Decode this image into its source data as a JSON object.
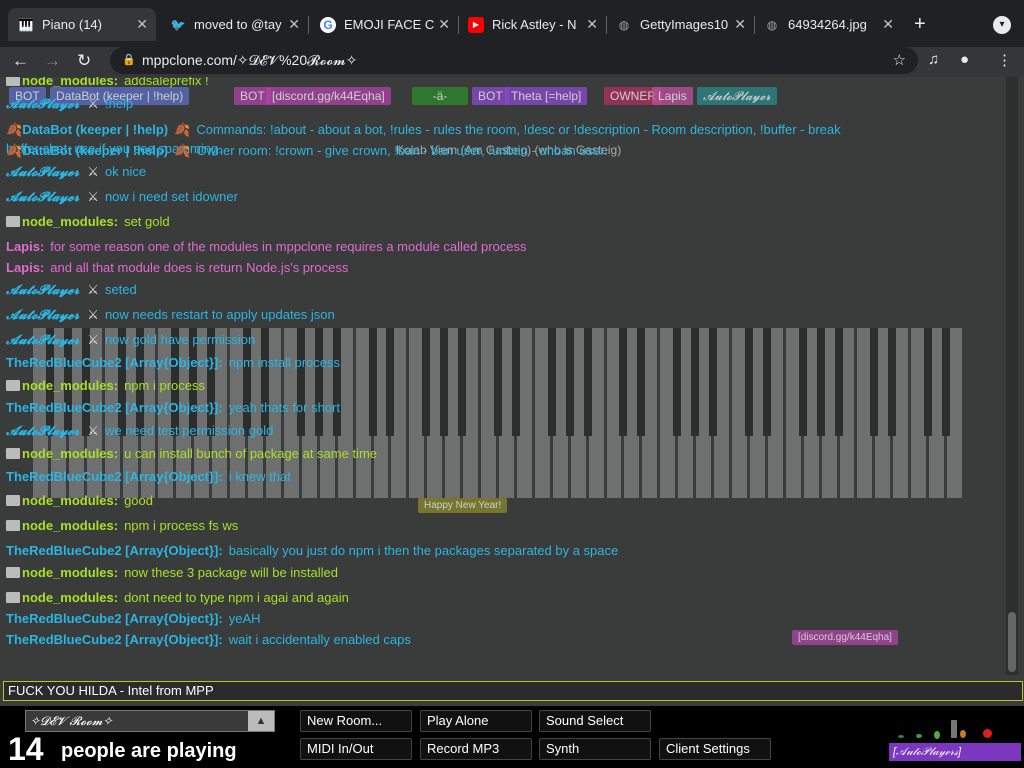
{
  "browser": {
    "tabs": [
      {
        "title": "Piano (14)",
        "icon": "piano-icon"
      },
      {
        "title": "moved to @tay",
        "icon": "twitter-icon"
      },
      {
        "title": "EMOJI FACE C",
        "icon": "google-icon"
      },
      {
        "title": "Rick Astley - N",
        "icon": "youtube-icon"
      },
      {
        "title": "GettyImages10",
        "icon": "globe-icon"
      },
      {
        "title": "64934264.jpg",
        "icon": "globe-icon"
      }
    ],
    "new_tab": "+",
    "url": "mppclone.com/✧𝓓𝓔𝓥%20𝓡𝓸𝓸𝓶✧"
  },
  "colors": {
    "accent": "#b9c728",
    "lime": "#a8e028",
    "cyan": "#2bb5e3",
    "pink": "#e06ad0"
  },
  "overlay_tags": [
    {
      "text": "BOT",
      "color": "#5b6fc8"
    },
    {
      "text": "DataBot (keeper | !help)",
      "color": "#5b6fc8"
    },
    {
      "text": "BOT",
      "color": "#b044a8"
    },
    {
      "text": "[discord.gg/k44Eqha]",
      "color": "#b044a8"
    },
    {
      "text": "-ä-",
      "color": "#2c8a2c"
    },
    {
      "text": "BOT",
      "color": "#8a4ad0"
    },
    {
      "text": "Theta [=help]",
      "color": "#8a4ad0"
    },
    {
      "text": "OWNER",
      "color": "#b03060"
    },
    {
      "text": "Lapis",
      "color": "#c050a0"
    },
    {
      "text": "𝓐𝓾𝓽𝓸𝓟𝓵𝓪𝔂𝓮𝓻",
      "color": "#2a8a8a"
    },
    {
      "text": "Kolab Viem (Am Gasteig) (who is Gasteig)",
      "color": "#3a3b3b"
    },
    {
      "text": "Happy New Year!",
      "color": "#8a8a2a"
    },
    {
      "text": "[discord.gg/k44Eqha]",
      "color": "#b044a8"
    }
  ],
  "chat": [
    {
      "name": "node_modules:",
      "text": "addsaleprefix !",
      "color": "#a8e028",
      "folder": true
    },
    {
      "name": "𝓐𝓾𝓽𝓸𝓟𝓵𝓪𝔂𝓮𝓻",
      "text": "!help",
      "color": "#2bb5e3",
      "sword": true
    },
    {
      "name": "DataBot (keeper | !help)",
      "text": "Commands: !about - about a bot, !rules - rules the room, !desc or !description - Room description, !buffer - break",
      "text2": "buffer chat, use if you see spamming.",
      "color": "#2bb5e3",
      "prefix": "🍂",
      "suffix": "🍂"
    },
    {
      "name": "DataBot (keeper | !help)",
      "text": "Owner room: !crown - give crown, !ban - ban user, !unban - unban user.",
      "color": "#2bb5e3",
      "prefix": "🍂",
      "suffix": "🍂"
    },
    {
      "name": "𝓐𝓾𝓽𝓸𝓟𝓵𝓪𝔂𝓮𝓻",
      "text": "ok nice",
      "color": "#2bb5e3",
      "sword": true
    },
    {
      "name": "𝓐𝓾𝓽𝓸𝓟𝓵𝓪𝔂𝓮𝓻",
      "text": "now i need set idowner",
      "color": "#2bb5e3",
      "sword": true
    },
    {
      "name": "node_modules:",
      "text": "set gold",
      "color": "#a8e028",
      "folder": true
    },
    {
      "name": "Lapis:",
      "text": "for some reason one of the modules in mppclone requires a module called process",
      "color": "#e06ad0"
    },
    {
      "name": "Lapis:",
      "text": "and all that module does is return Node.js's process",
      "color": "#e06ad0"
    },
    {
      "name": "𝓐𝓾𝓽𝓸𝓟𝓵𝓪𝔂𝓮𝓻",
      "text": "seted",
      "color": "#2bb5e3",
      "sword": true
    },
    {
      "name": "𝓐𝓾𝓽𝓸𝓟𝓵𝓪𝔂𝓮𝓻",
      "text": "now needs restart to apply updates json",
      "color": "#2bb5e3",
      "sword": true
    },
    {
      "name": "𝓐𝓾𝓽𝓸𝓟𝓵𝓪𝔂𝓮𝓻",
      "text": "now gold have permission",
      "color": "#2bb5e3",
      "sword": true
    },
    {
      "name": "TheRedBlueCube2 [Array{Object}]:",
      "text": "npm install process",
      "color": "#2bb5e3"
    },
    {
      "name": "node_modules:",
      "text": "npm i process",
      "color": "#a8e028",
      "folder": true
    },
    {
      "name": "TheRedBlueCube2 [Array{Object}]:",
      "text": "yeah thats for short",
      "color": "#2bb5e3"
    },
    {
      "name": "𝓐𝓾𝓽𝓸𝓟𝓵𝓪𝔂𝓮𝓻",
      "text": "we need test permission gold",
      "color": "#2bb5e3",
      "sword": true
    },
    {
      "name": "node_modules:",
      "text": "u can install bunch of package at same time",
      "color": "#a8e028",
      "folder": true
    },
    {
      "name": "TheRedBlueCube2 [Array{Object}]:",
      "text": "i knew that",
      "color": "#2bb5e3"
    },
    {
      "name": "node_modules:",
      "text": "good",
      "color": "#a8e028",
      "folder": true
    },
    {
      "name": "node_modules:",
      "text": "npm i process fs ws",
      "color": "#a8e028",
      "folder": true
    },
    {
      "name": "TheRedBlueCube2 [Array{Object}]:",
      "text": "basically you just do npm i then the packages separated by a space",
      "color": "#2bb5e3"
    },
    {
      "name": "node_modules:",
      "text": "now these 3 package will be installed",
      "color": "#a8e028",
      "folder": true
    },
    {
      "name": "node_modules:",
      "text": "dont need to type npm i agai and again",
      "color": "#a8e028",
      "folder": true
    },
    {
      "name": "TheRedBlueCube2 [Array{Object}]:",
      "text": "yeAH",
      "color": "#2bb5e3"
    },
    {
      "name": "TheRedBlueCube2 [Array{Object}]:",
      "text": "wait i accidentally enabled caps",
      "color": "#2bb5e3"
    }
  ],
  "chat_input": "FUCK YOU HILDA - Intel from MPP",
  "room": {
    "name": "✧𝓓𝓔𝓥 𝓡𝓸𝓸𝓶✧",
    "count": "14",
    "label": "people are playing"
  },
  "buttons": {
    "new_room": "New Room...",
    "play_alone": "Play Alone",
    "sound_select": "Sound Select",
    "midi": "MIDI In/Out",
    "record": "Record MP3",
    "synth": "Synth",
    "client_settings": "Client Settings"
  },
  "cursor_badge": "[𝒜𝓊𝓉ℴ𝒫𝓁𝒶𝓎ℯ𝓇𝓈]"
}
